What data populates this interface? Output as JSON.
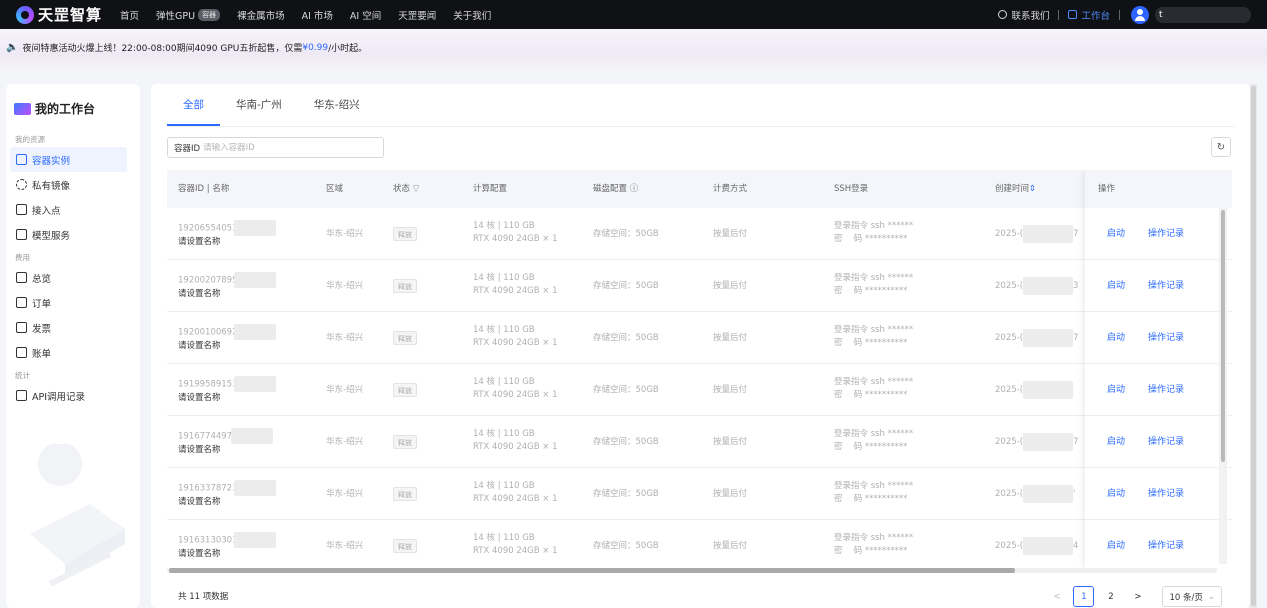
{
  "brand": {
    "name": "天罡智算"
  },
  "nav": [
    {
      "label": "首页"
    },
    {
      "label": "弹性GPU",
      "badge": "容器"
    },
    {
      "label": "裸金属市场"
    },
    {
      "label": "AI 市场"
    },
    {
      "label": "AI 空间"
    },
    {
      "label": "天罡要闻"
    },
    {
      "label": "关于我们"
    }
  ],
  "topright": {
    "contact": "联系我们",
    "workspace": "工作台",
    "username": "t"
  },
  "announcement": {
    "prefix": "夜间特惠活动火爆上线！22:00-08:00期间4090 GPU五折起售，仅需",
    "price": "¥0.99",
    "suffix": "/小时起。"
  },
  "sidebar": {
    "title": "我的工作台",
    "groups": [
      {
        "label": "我的资源",
        "items": [
          {
            "label": "容器实例",
            "icon": "container-icon",
            "active": true
          },
          {
            "label": "私有镜像",
            "icon": "image-icon"
          },
          {
            "label": "接入点",
            "icon": "endpoint-icon"
          },
          {
            "label": "模型服务",
            "icon": "model-service-icon"
          }
        ]
      },
      {
        "label": "费用",
        "items": [
          {
            "label": "总览",
            "icon": "overview-icon"
          },
          {
            "label": "订单",
            "icon": "order-icon"
          },
          {
            "label": "发票",
            "icon": "invoice-icon"
          },
          {
            "label": "账单",
            "icon": "bill-icon"
          }
        ]
      },
      {
        "label": "统计",
        "items": [
          {
            "label": "API调用记录",
            "icon": "api-icon"
          }
        ]
      }
    ]
  },
  "tabs": [
    {
      "label": "全部",
      "active": true
    },
    {
      "label": "华南-广州"
    },
    {
      "label": "华东-绍兴"
    }
  ],
  "search": {
    "label": "容器ID",
    "placeholder": "请输入容器ID"
  },
  "columns": [
    "容器ID | 名称",
    "区域",
    "状态",
    "计算配置",
    "磁盘配置",
    "计费方式",
    "SSH登录",
    "创建时间",
    "操作"
  ],
  "rows": [
    {
      "id": "19206554053",
      "name": "请设置名称",
      "region": "华东-绍兴",
      "status": "释放",
      "cpu": "14 核 | 110 GB",
      "gpu": "RTX 4090 24GB × 1",
      "disk": "存储空间：50GB",
      "billing": "按量后付",
      "ssh_cmd": "登录指令 ssh ******",
      "ssh_pwd": "密　  码 **********",
      "created": "2025-(",
      "created_tail": "7"
    },
    {
      "id": "19200207895",
      "name": "请设置名称",
      "region": "华东-绍兴",
      "status": "释放",
      "cpu": "14 核 | 110 GB",
      "gpu": "RTX 4090 24GB × 1",
      "disk": "存储空间：50GB",
      "billing": "按量后付",
      "ssh_cmd": "登录指令 ssh ******",
      "ssh_pwd": "密　  码 **********",
      "created": "2025-(",
      "created_tail": "3"
    },
    {
      "id": "19200100692",
      "name": "请设置名称",
      "region": "华东-绍兴",
      "status": "释放",
      "cpu": "14 核 | 110 GB",
      "gpu": "RTX 4090 24GB × 1",
      "disk": "存储空间：50GB",
      "billing": "按量后付",
      "ssh_cmd": "登录指令 ssh ******",
      "ssh_pwd": "密　  码 **********",
      "created": "2025-(",
      "created_tail": "7"
    },
    {
      "id": "19199589153",
      "name": "请设置名称",
      "region": "华东-绍兴",
      "status": "释放",
      "cpu": "14 核 | 110 GB",
      "gpu": "RTX 4090 24GB × 1",
      "disk": "存储空间：50GB",
      "billing": "按量后付",
      "ssh_cmd": "登录指令 ssh ******",
      "ssh_pwd": "密　  码 **********",
      "created": "2025-(",
      "created_tail": ""
    },
    {
      "id": "1916774497(",
      "name": "请设置名称",
      "region": "华东-绍兴",
      "status": "释放",
      "cpu": "14 核 | 110 GB",
      "gpu": "RTX 4090 24GB × 1",
      "disk": "存储空间：50GB",
      "billing": "按量后付",
      "ssh_cmd": "登录指令 ssh ******",
      "ssh_pwd": "密　  码 **********",
      "created": "2025-(",
      "created_tail": "7"
    },
    {
      "id": "19163378723",
      "name": "请设置名称",
      "region": "华东-绍兴",
      "status": "释放",
      "cpu": "14 核 | 110 GB",
      "gpu": "RTX 4090 24GB × 1",
      "disk": "存储空间：50GB",
      "billing": "按量后付",
      "ssh_cmd": "登录指令 ssh ******",
      "ssh_pwd": "密　  码 **********",
      "created": "2025-(",
      "created_tail": "'"
    },
    {
      "id": "19163130301",
      "name": "请设置名称",
      "region": "华东-绍兴",
      "status": "释放",
      "cpu": "14 核 | 110 GB",
      "gpu": "RTX 4090 24GB × 1",
      "disk": "存储空间：50GB",
      "billing": "按量后付",
      "ssh_cmd": "登录指令 ssh ******",
      "ssh_pwd": "密　  码 **********",
      "created": "2025-(",
      "created_tail": "4"
    }
  ],
  "actions": {
    "start": "启动",
    "log": "操作记录"
  },
  "pagination": {
    "total": "共 11 项数据",
    "prev": "<",
    "pages": [
      "1",
      "2"
    ],
    "current": "1",
    "next": ">",
    "page_size": "10 条/页"
  },
  "colors": {
    "accent": "#2d6bff",
    "topbar": "#101114"
  }
}
